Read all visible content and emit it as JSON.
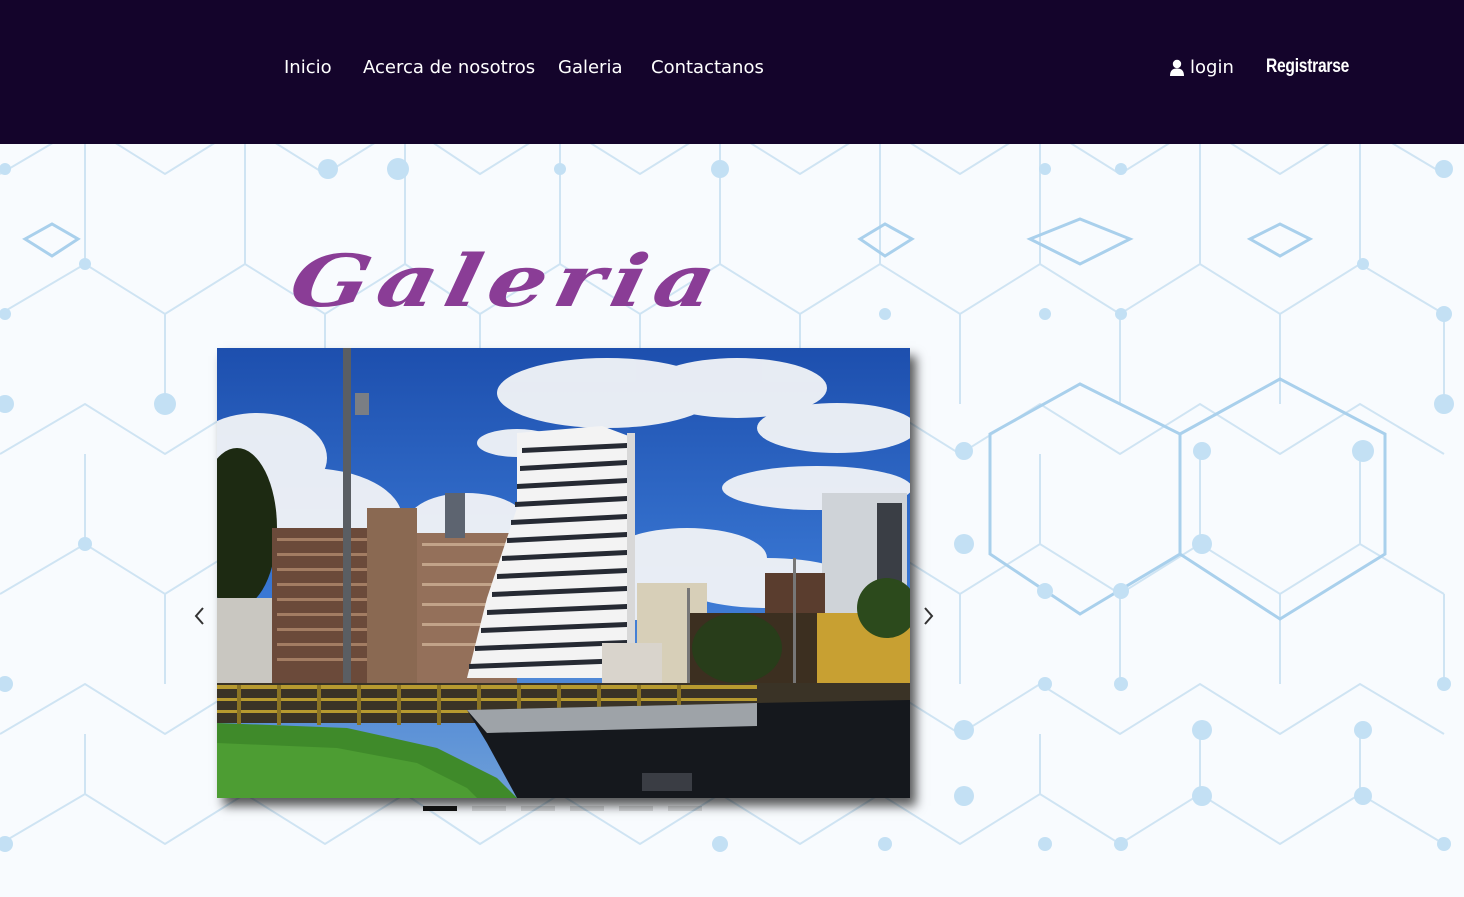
{
  "nav": {
    "links": [
      {
        "label": "Inicio"
      },
      {
        "label": "Acerca de nosotros"
      },
      {
        "label": "Galeria"
      },
      {
        "label": "Contactanos"
      }
    ],
    "login_label": "login",
    "register_label": "Registrarse"
  },
  "page": {
    "title": "Galeria"
  },
  "carousel": {
    "slide_count": 6,
    "active_index": 0
  },
  "colors": {
    "header_bg": "#14042b",
    "title": "#8a3d96",
    "pattern": "#bcdcf1"
  },
  "icons": {
    "login": "user-icon",
    "prev": "chevron-left-icon",
    "next": "chevron-right-icon"
  }
}
